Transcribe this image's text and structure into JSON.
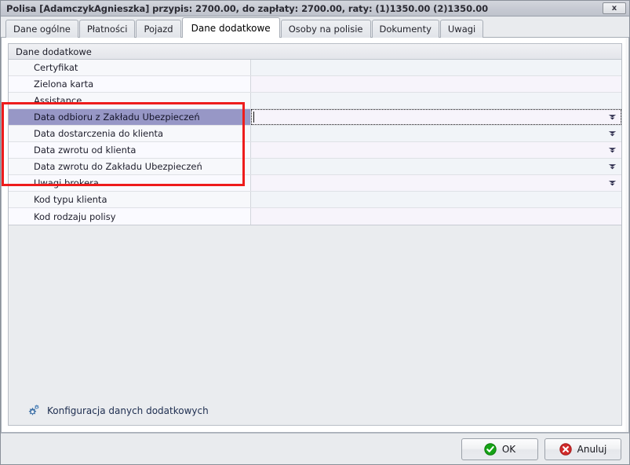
{
  "window": {
    "title": "Polisa [AdamczykAgnieszka] przypis: 2700.00, do zapłaty: 2700.00, raty: (1)1350.00 (2)1350.00",
    "close_label": "x"
  },
  "tabs": [
    {
      "label": "Dane ogólne",
      "active": false
    },
    {
      "label": "Płatności",
      "active": false
    },
    {
      "label": "Pojazd",
      "active": false
    },
    {
      "label": "Dane dodatkowe",
      "active": true
    },
    {
      "label": "Osoby na polisie",
      "active": false
    },
    {
      "label": "Dokumenty",
      "active": false
    },
    {
      "label": "Uwagi",
      "active": false
    }
  ],
  "group": {
    "header": "Dane dodatkowe"
  },
  "grid": {
    "rows": [
      {
        "label": "Certyfikat",
        "value": "",
        "dropdown": false,
        "selected": false
      },
      {
        "label": "Zielona karta",
        "value": "",
        "dropdown": false,
        "selected": false
      },
      {
        "label": "Assistance",
        "value": "",
        "dropdown": false,
        "selected": false
      },
      {
        "label": "Data odbioru z Zakładu Ubezpieczeń",
        "value": "",
        "dropdown": true,
        "selected": true
      },
      {
        "label": "Data dostarczenia do klienta",
        "value": "",
        "dropdown": true,
        "selected": false
      },
      {
        "label": "Data zwrotu od klienta",
        "value": "",
        "dropdown": true,
        "selected": false
      },
      {
        "label": "Data zwrotu do Zakładu Ubezpieczeń",
        "value": "",
        "dropdown": true,
        "selected": false
      },
      {
        "label": "Uwagi brokera",
        "value": "",
        "dropdown": true,
        "selected": false
      },
      {
        "label": "Kod typu klienta",
        "value": "",
        "dropdown": false,
        "selected": false
      },
      {
        "label": "Kod rodzaju polisy",
        "value": "",
        "dropdown": false,
        "selected": false
      }
    ]
  },
  "annotation": {
    "color": "#ee1c1c",
    "covers_rows": [
      3,
      4,
      5,
      6,
      7
    ]
  },
  "config_link": {
    "label": "Konfiguracja danych dodatkowych",
    "icon": "gear-icon"
  },
  "footer": {
    "ok_label": "OK",
    "cancel_label": "Anuluj",
    "ok_color": "#16a416",
    "cancel_color": "#d12a2a"
  }
}
